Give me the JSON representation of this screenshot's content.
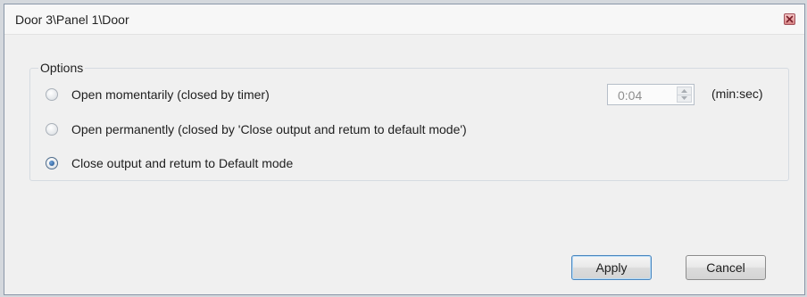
{
  "window": {
    "title": "Door 3\\Panel 1\\Door"
  },
  "options_group": {
    "label": "Options",
    "radios": [
      {
        "label": "Open momentarily (closed by timer)",
        "checked": false
      },
      {
        "label": "Open permanently (closed by 'Close output and retum to default mode')",
        "checked": false
      },
      {
        "label": "Close output and retum to Default mode",
        "checked": true
      }
    ]
  },
  "timer": {
    "value": "0:04",
    "unit": "(min:sec)",
    "enabled": false
  },
  "buttons": {
    "apply": "Apply",
    "cancel": "Cancel"
  },
  "icons": {
    "close": "close-icon",
    "spin_up": "chevron-up-icon",
    "spin_down": "chevron-down-icon"
  },
  "colors": {
    "accent": "#4b87bf",
    "close_button": "#d98686"
  }
}
